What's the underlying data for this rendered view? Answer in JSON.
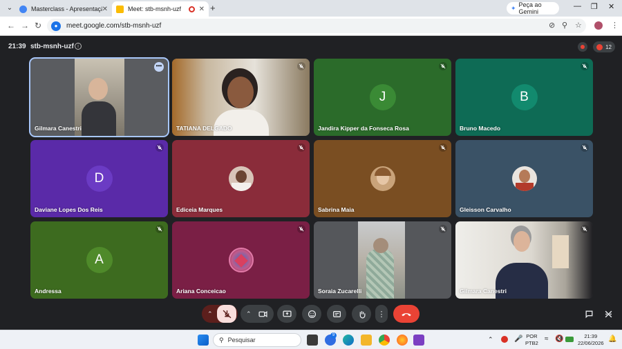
{
  "browser": {
    "tabs": [
      {
        "title": "Masterclass - Apresentação",
        "favicon_color": "#4285f4",
        "active": false
      },
      {
        "title": "Meet: stb-msnh-uzf",
        "favicon_color": "#fbbc04",
        "active": true
      }
    ],
    "gemini_label": "Peça ao Gemini",
    "url": "meet.google.com/stb-msnh-uzf"
  },
  "meeting": {
    "time": "21:39",
    "code": "stb-msnh-uzf",
    "participant_count": "12"
  },
  "tiles": [
    {
      "name": "Gilmara Canestri",
      "kind": "video",
      "bg": "#5a5c60",
      "muted": false,
      "selected": true
    },
    {
      "name": "TATIANA DELGADO",
      "kind": "video",
      "bg": "#9b8a72",
      "muted": true
    },
    {
      "name": "Jandira Kipper da Fonseca Rosa",
      "kind": "letter",
      "letter": "J",
      "bg": "#2b6b2a",
      "avatar_bg": "#3a8a35",
      "muted": true
    },
    {
      "name": "Bruno Macedo",
      "kind": "letter",
      "letter": "B",
      "bg": "#0e6b55",
      "avatar_bg": "#128a6e",
      "muted": true
    },
    {
      "name": "Daviane Lopes Dos Reis",
      "kind": "letter",
      "letter": "D",
      "bg": "#5a2aa8",
      "avatar_bg": "#6b3bc4",
      "muted": true
    },
    {
      "name": "Ediceia Marques",
      "kind": "photo",
      "bg": "#8a2c3a",
      "photo_bg": "#d8c4b8",
      "muted": true
    },
    {
      "name": "Sabrina Maia",
      "kind": "photo",
      "bg": "#7a4e22",
      "photo_bg": "#c9a37a",
      "muted": true
    },
    {
      "name": "Gleisson Carvalho",
      "kind": "photo",
      "bg": "#3a5266",
      "photo_bg": "#b57a58",
      "muted": true
    },
    {
      "name": "Andressa",
      "kind": "letter",
      "letter": "A",
      "bg": "#3d6b1f",
      "avatar_bg": "#4f8a2a",
      "muted": true
    },
    {
      "name": "Ariana Conceicao",
      "kind": "photo",
      "bg": "#7a1f45",
      "photo_bg": "#c25a8a",
      "muted": true
    },
    {
      "name": "Soraia Zucarelli",
      "kind": "video",
      "bg": "#55575b",
      "muted": true
    },
    {
      "name": "Gilmara Canestri",
      "kind": "video",
      "bg": "#3a3f47",
      "muted": true
    }
  ],
  "taskbar": {
    "search_placeholder": "Pesquisar",
    "lang": "POR",
    "layout": "PTB2",
    "clock_time": "21:39",
    "clock_date": "22/06/2026",
    "badge_count": "9"
  }
}
